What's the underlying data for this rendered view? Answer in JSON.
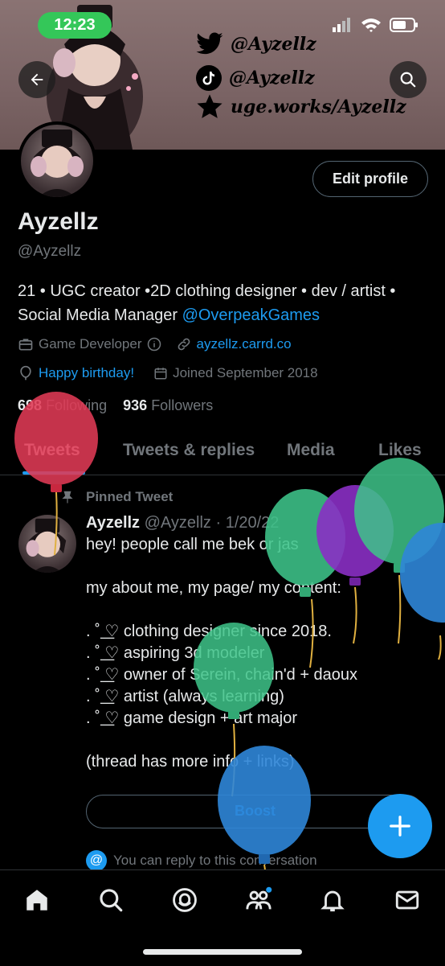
{
  "status": {
    "time": "12:23"
  },
  "banner": {
    "twitter": "@Ayzellz",
    "tiktok": "@Ayzellz",
    "site": "uge.works/Ayzellz"
  },
  "profile": {
    "name": "Ayzellz",
    "handle": "@Ayzellz",
    "edit_label": "Edit profile",
    "bio_text": "21 • UGC creator •2D clothing designer • dev / artist • Social Media Manager ",
    "bio_mention": "@OverpeakGames",
    "category": "Game Developer",
    "website": "ayzellz.carrd.co",
    "birthday": "Happy birthday!",
    "joined": "Joined September 2018",
    "following_count": "698",
    "following_label": "Following",
    "followers_count": "936",
    "followers_label": "Followers"
  },
  "tabs": [
    "Tweets",
    "Tweets & replies",
    "Media",
    "Likes"
  ],
  "tweet": {
    "pinned_label": "Pinned Tweet",
    "author": "Ayzellz",
    "handle_date": "@Ayzellz · 1/20/22",
    "body": "hey! people call me bek or jas\n\nmy about me, my page/ my content:\n\n. ˚ ͟♡ clothing designer since 2018.\n. ˚ ͟♡ aspiring 3d modeler\n. ˚ ͟♡ owner of Serein, chain'd + daoux\n. ˚ ͟♡ artist (always learning)\n. ˚ ͟♡ game design + art major\n\n(thread has more info + links)",
    "boost_label": "Boost",
    "reply_note": "You can reply to this conversation"
  },
  "colors": {
    "accent": "#1d9bf0",
    "time_pill": "#34c759",
    "background": "#000000"
  },
  "icons": [
    "twitter-icon",
    "tiktok-icon",
    "star-icon",
    "back-arrow-icon",
    "search-icon",
    "briefcase-icon",
    "link-icon",
    "balloon-icon",
    "calendar-icon",
    "pin-icon",
    "compose-plus-icon",
    "home-icon",
    "spaces-icon",
    "communities-icon",
    "notifications-icon",
    "messages-icon"
  ]
}
